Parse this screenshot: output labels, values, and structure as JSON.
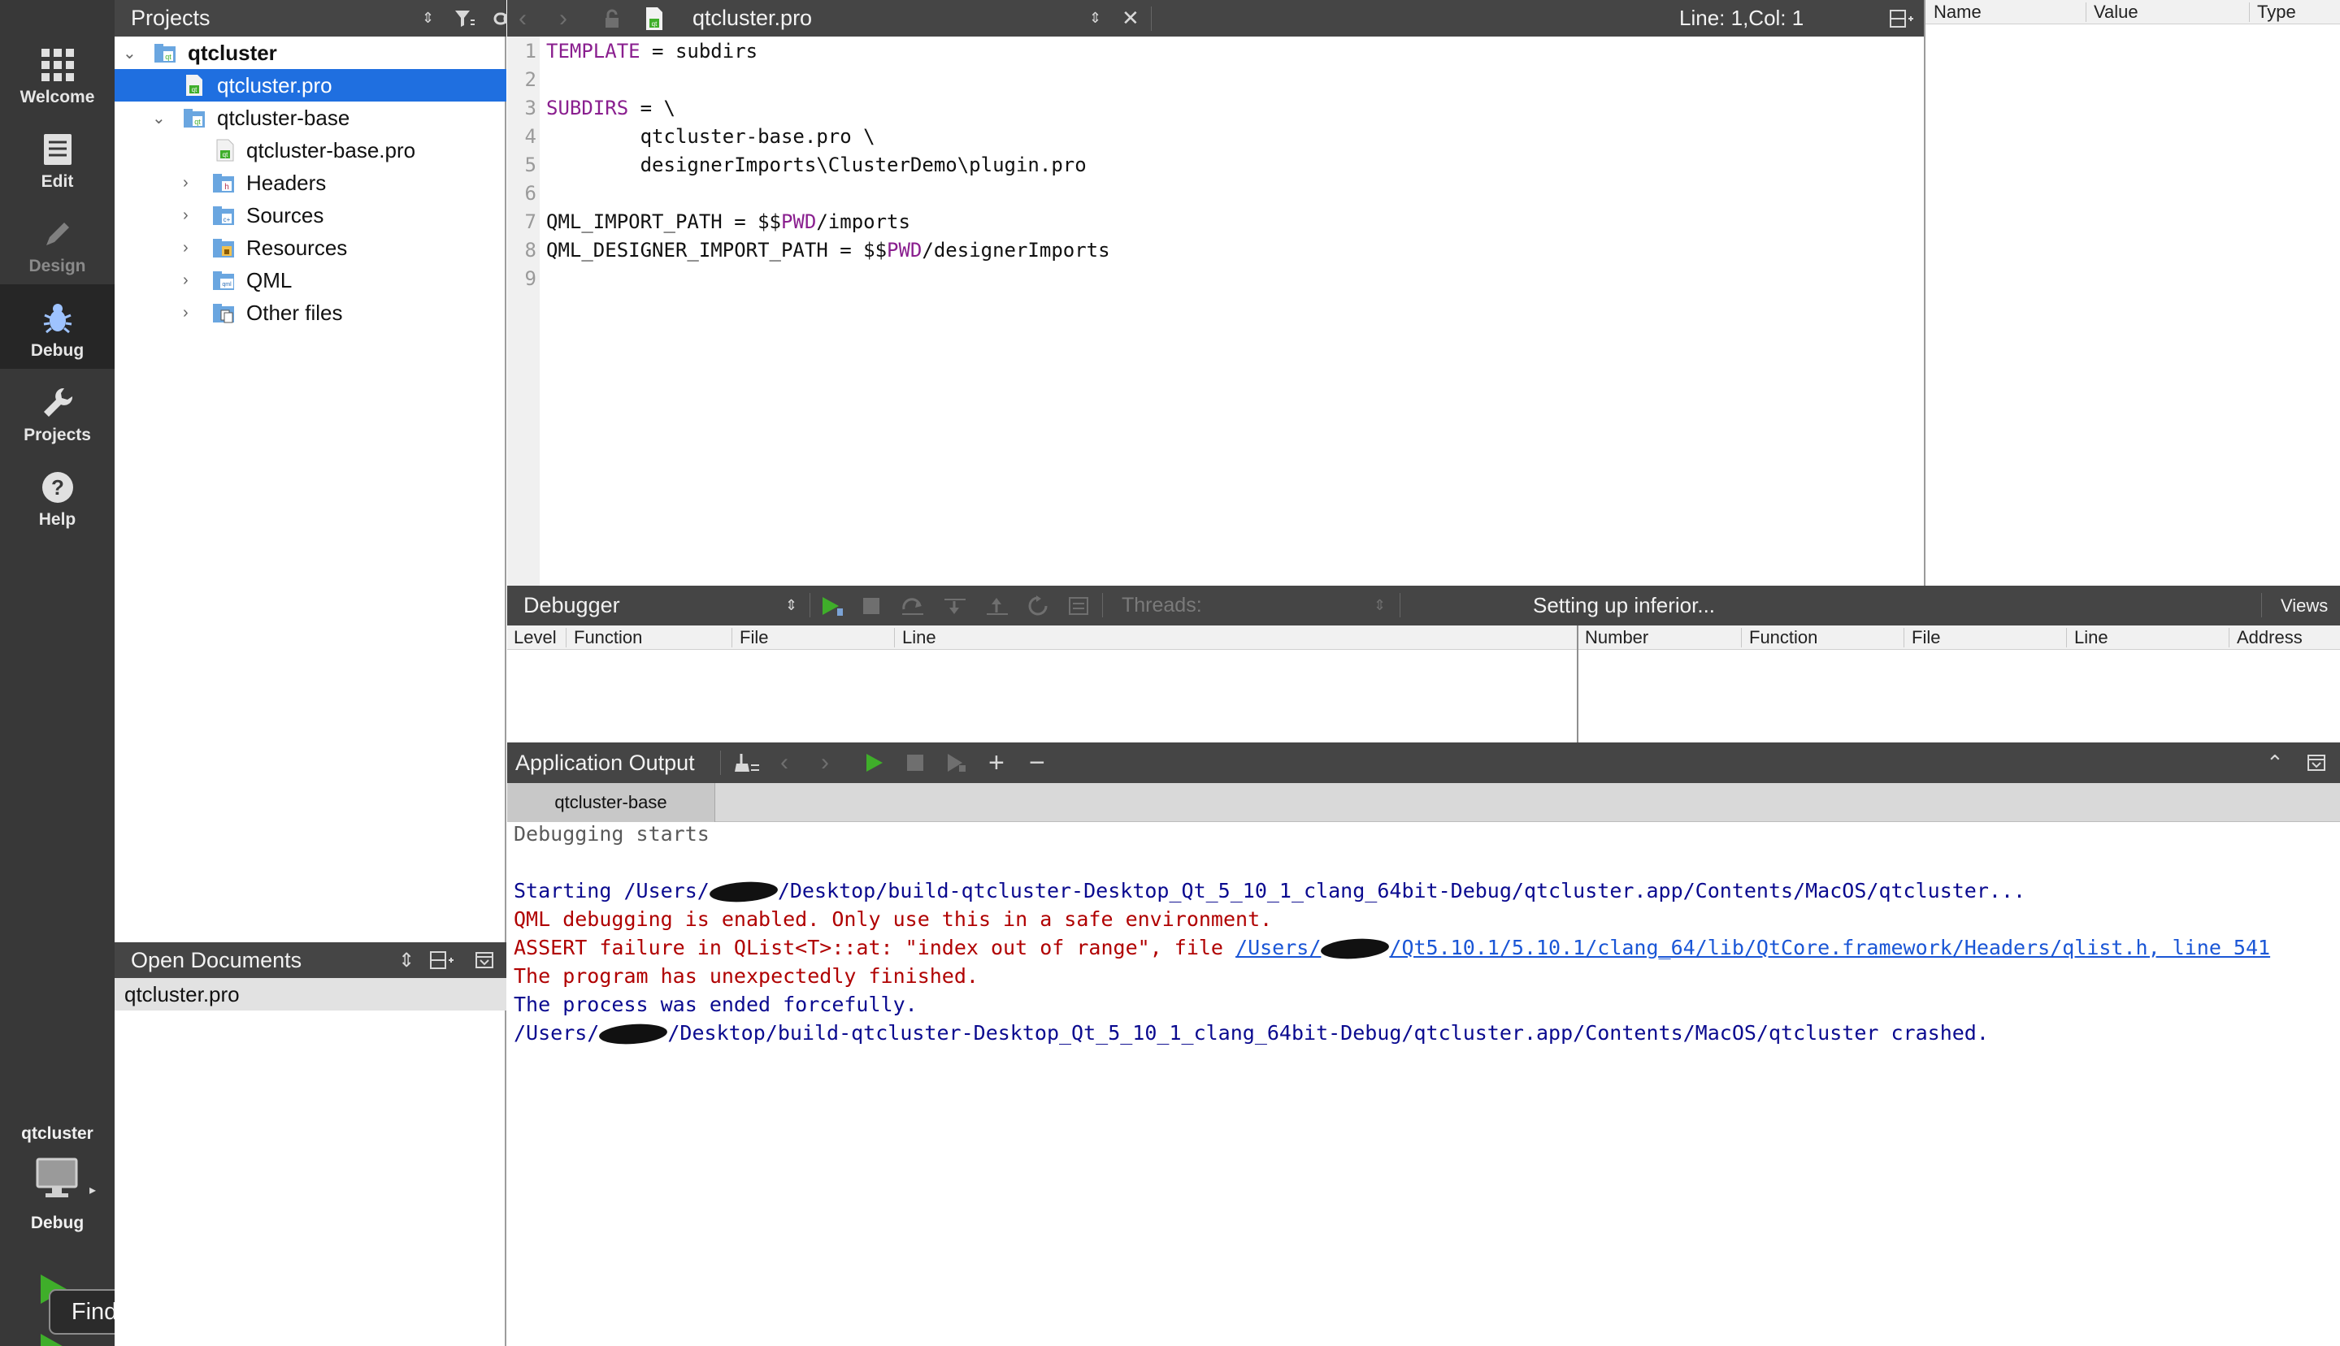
{
  "modes": [
    {
      "label": "Welcome",
      "icon": "grid-icon"
    },
    {
      "label": "Edit",
      "icon": "document-icon"
    },
    {
      "label": "Design",
      "icon": "pencil-icon"
    },
    {
      "label": "Debug",
      "icon": "bug-icon"
    },
    {
      "label": "Projects",
      "icon": "wrench-icon"
    },
    {
      "label": "Help",
      "icon": "question-icon"
    }
  ],
  "kit": {
    "project": "qtcluster",
    "build": "Debug"
  },
  "tooltip": "Finder",
  "projects_pane": {
    "title": "Projects",
    "tree": [
      {
        "label": "qtcluster",
        "bold": true,
        "level": 0,
        "expanded": true,
        "icon": "project-folder-icon"
      },
      {
        "label": "qtcluster.pro",
        "level": 1,
        "selected": true,
        "icon": "pro-file-icon"
      },
      {
        "label": "qtcluster-base",
        "level": 1,
        "expanded": true,
        "icon": "project-folder-icon"
      },
      {
        "label": "qtcluster-base.pro",
        "level": 2,
        "icon": "pro-file-icon"
      },
      {
        "label": "Headers",
        "level": 2,
        "collapsed": true,
        "icon": "headers-folder-icon"
      },
      {
        "label": "Sources",
        "level": 2,
        "collapsed": true,
        "icon": "sources-folder-icon"
      },
      {
        "label": "Resources",
        "level": 2,
        "collapsed": true,
        "icon": "resources-folder-icon"
      },
      {
        "label": "QML",
        "level": 2,
        "collapsed": true,
        "icon": "qml-folder-icon"
      },
      {
        "label": "Other files",
        "level": 2,
        "collapsed": true,
        "icon": "other-files-folder-icon"
      }
    ]
  },
  "open_documents": {
    "title": "Open Documents",
    "items": [
      "qtcluster.pro"
    ]
  },
  "editor": {
    "file": "qtcluster.pro",
    "position": "Line: 1,Col: 1",
    "lines": [
      {
        "n": "1",
        "parts": [
          {
            "t": "TEMPLATE",
            "kw": true
          },
          {
            "t": " = subdirs"
          }
        ]
      },
      {
        "n": "2",
        "parts": []
      },
      {
        "n": "3",
        "parts": [
          {
            "t": "SUBDIRS",
            "kw": true
          },
          {
            "t": " = \\"
          }
        ]
      },
      {
        "n": "4",
        "parts": [
          {
            "t": "        qtcluster-base.pro \\"
          }
        ]
      },
      {
        "n": "5",
        "parts": [
          {
            "t": "        designerImports\\ClusterDemo\\plugin.pro"
          }
        ]
      },
      {
        "n": "6",
        "parts": []
      },
      {
        "n": "7",
        "parts": [
          {
            "t": "QML_IMPORT_PATH = $$"
          },
          {
            "t": "PWD",
            "kw": true
          },
          {
            "t": "/imports"
          }
        ]
      },
      {
        "n": "8",
        "parts": [
          {
            "t": "QML_DESIGNER_IMPORT_PATH = $$"
          },
          {
            "t": "PWD",
            "kw": true
          },
          {
            "t": "/designerImports"
          }
        ]
      },
      {
        "n": "9",
        "parts": []
      }
    ]
  },
  "locals": {
    "columns": [
      "Name",
      "Value",
      "Type"
    ]
  },
  "debugger": {
    "selector": "Debugger",
    "threads_label": "Threads:",
    "status": "Setting up inferior...",
    "views": "Views",
    "stack_columns": [
      "Level",
      "Function",
      "File",
      "Line"
    ],
    "breakpoint_columns": [
      "Number",
      "Function",
      "File",
      "Line",
      "Address"
    ]
  },
  "app_output": {
    "title": "Application Output",
    "tab": "qtcluster-base",
    "lines": [
      {
        "color": "grey",
        "text": "Debugging starts"
      },
      {
        "color": "blue",
        "text": ""
      },
      {
        "color": "blue",
        "pre": "Starting /Users/",
        "redact": true,
        "post": "/Desktop/build-qtcluster-Desktop_Qt_5_10_1_clang_64bit-Debug/qtcluster.app/Contents/MacOS/qtcluster..."
      },
      {
        "color": "red",
        "text": "QML debugging is enabled. Only use this in a safe environment."
      },
      {
        "color": "red",
        "pre": "ASSERT failure in QList<T>::at: \"index out of range\", file ",
        "link_pre": "/Users/",
        "redact": true,
        "link_post": "/Qt5.10.1/5.10.1/clang_64/lib/QtCore.framework/Headers/qlist.h, line 541"
      },
      {
        "color": "red",
        "text": "The program has unexpectedly finished."
      },
      {
        "color": "blue",
        "text": "The process was ended forcefully."
      },
      {
        "color": "blue",
        "pre": "/Users/",
        "redact": true,
        "post": "/Desktop/build-qtcluster-Desktop_Qt_5_10_1_clang_64bit-Debug/qtcluster.app/Contents/MacOS/qtcluster crashed."
      }
    ]
  }
}
